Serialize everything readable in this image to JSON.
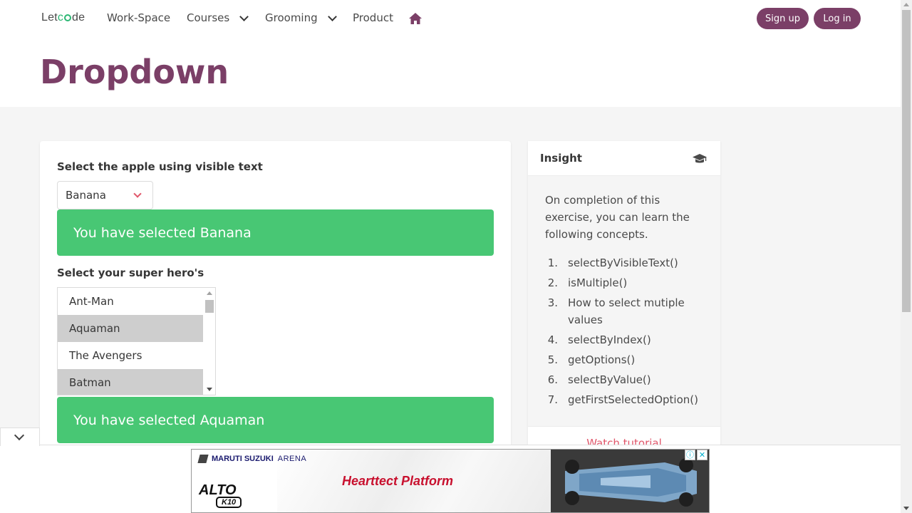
{
  "navbar": {
    "brand_prefix": "Let",
    "brand_suffix": "de",
    "items": [
      {
        "label": "Work-Space"
      },
      {
        "label": "Courses"
      },
      {
        "label": "Grooming"
      },
      {
        "label": "Product"
      }
    ],
    "signup_label": "Sign up",
    "login_label": "Log in",
    "accent_color": "#7b3f67"
  },
  "hero": {
    "title": "Dropdown"
  },
  "main": {
    "fruit_label": "Select the apple using visible text",
    "fruit_selected": "Banana",
    "fruit_notice": "You have selected Banana",
    "hero_label": "Select your super hero's",
    "heroes": [
      {
        "label": "Ant-Man",
        "selected": false
      },
      {
        "label": "Aquaman",
        "selected": true
      },
      {
        "label": "The Avengers",
        "selected": false
      },
      {
        "label": "Batman",
        "selected": true
      }
    ],
    "hero_notice": "You have selected Aquaman",
    "success_color": "#48c774"
  },
  "insight": {
    "title": "Insight",
    "intro": "On completion of this exercise, you can learn the following concepts.",
    "concepts": [
      {
        "num": "1.",
        "text": "selectByVisibleText()"
      },
      {
        "num": "2.",
        "text": "isMultiple()"
      },
      {
        "num": "3.",
        "text": "How to select mutiple values"
      },
      {
        "num": "4.",
        "text": "selectByIndex()"
      },
      {
        "num": "5.",
        "text": "getOptions()"
      },
      {
        "num": "6.",
        "text": "selectByValue()"
      },
      {
        "num": "7.",
        "text": "getFirstSelectedOption()"
      }
    ],
    "footer_link": "Watch tutorial"
  },
  "ad": {
    "brand_a": "MARUTI SUZUKI",
    "brand_b": "ARENA",
    "model": "ALTO",
    "variant": "K10",
    "headline": "Hearttect Platform",
    "info_icon": "ⓘ",
    "close_icon": "✕"
  }
}
